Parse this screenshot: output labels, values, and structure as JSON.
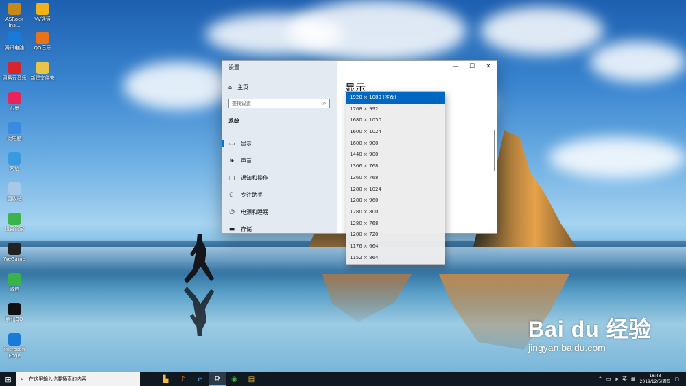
{
  "desktop_icons": [
    {
      "label": "ASRock Ins...",
      "icon": "app-icon",
      "color": "#c58a1a"
    },
    {
      "label": "VV通话",
      "icon": "phone-icon",
      "color": "#f0b21a"
    },
    {
      "label": "腾讯电脑",
      "icon": "browser-icon",
      "color": "#1a7ad8"
    },
    {
      "label": "QQ音乐",
      "icon": "music-icon",
      "color": "#e8731a"
    },
    {
      "label": "网易云音乐",
      "icon": "music-icon",
      "color": "#d8242a"
    },
    {
      "label": "新建文件夹",
      "icon": "folder-icon",
      "color": "#e8c44a"
    },
    {
      "label": "石墨",
      "icon": "doc-icon",
      "color": "#e8245a"
    },
    {
      "label": "此电脑",
      "icon": "computer-icon",
      "color": "#3a8ae0"
    },
    {
      "label": "网络",
      "icon": "network-icon",
      "color": "#3a9ae0"
    },
    {
      "label": "回收站",
      "icon": "recycle-bin-icon",
      "color": "#a8c8e8"
    },
    {
      "label": "设置管家",
      "icon": "shield-icon",
      "color": "#3ab44a"
    },
    {
      "label": "WeGame",
      "icon": "game-icon",
      "color": "#222222"
    },
    {
      "label": "微信",
      "icon": "wechat-icon",
      "color": "#3ab44a"
    },
    {
      "label": "腾讯QQ",
      "icon": "qq-icon",
      "color": "#111111"
    },
    {
      "label": "Microsoft Edge",
      "icon": "edge-icon",
      "color": "#1a7ad8"
    }
  ],
  "settings": {
    "window_title": "设置",
    "home_label": "主页",
    "search_placeholder": "查找设置",
    "section_label": "系统",
    "nav_items": [
      {
        "label": "显示",
        "icon": "monitor-icon",
        "glyph": "▭",
        "active": true
      },
      {
        "label": "声音",
        "icon": "speaker-icon",
        "glyph": "🕪",
        "active": false
      },
      {
        "label": "通知和操作",
        "icon": "notification-icon",
        "glyph": "▢",
        "active": false
      },
      {
        "label": "专注助手",
        "icon": "moon-icon",
        "glyph": "☾",
        "active": false
      },
      {
        "label": "电源和睡眠",
        "icon": "power-icon",
        "glyph": "⏻",
        "active": false
      },
      {
        "label": "存储",
        "icon": "storage-icon",
        "glyph": "▬",
        "active": false
      }
    ],
    "page_title": "显示",
    "window_controls": {
      "minimize": "—",
      "maximize": "☐",
      "close": "✕"
    }
  },
  "resolution_dropdown": {
    "selected_index": 0,
    "options": [
      "1920 × 1080 (推荐)",
      "1768 × 992",
      "1680 × 1050",
      "1600 × 1024",
      "1600 × 900",
      "1440 × 900",
      "1366 × 768",
      "1360 × 768",
      "1280 × 1024",
      "1280 × 960",
      "1280 × 800",
      "1280 × 768",
      "1280 × 720",
      "1176 × 664",
      "1152 × 864"
    ]
  },
  "watermark": {
    "logo": "Bai du 经验",
    "url": "jingyan.baidu.com"
  },
  "taskbar": {
    "search_placeholder": "在这里输入你要搜索的内容",
    "apps": [
      {
        "name": "libraries-icon",
        "glyph": "▙",
        "color": "#f0c040",
        "active": false
      },
      {
        "name": "music-app-icon",
        "glyph": "♪",
        "color": "#e8731a",
        "active": false
      },
      {
        "name": "edge-icon",
        "glyph": "e",
        "color": "#3a9ae0",
        "active": false
      },
      {
        "name": "settings-icon",
        "glyph": "⚙",
        "color": "#ffffff",
        "active": true
      },
      {
        "name": "wechat-icon",
        "glyph": "◉",
        "color": "#3ab44a",
        "active": false
      },
      {
        "name": "file-explorer-icon",
        "glyph": "▤",
        "color": "#f0c040",
        "active": false
      }
    ],
    "tray": {
      "chevron": "^",
      "ime": "英",
      "time": "18:43",
      "date": "2019/12/5/周四"
    }
  }
}
